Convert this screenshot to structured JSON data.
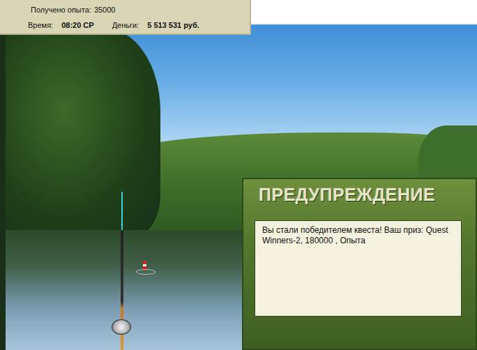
{
  "header": {
    "experience_label": "Получено опыта:",
    "experience_value": "35000",
    "time_label": "Время:",
    "time_value": "08:20 СР",
    "money_label": "Деньги:",
    "money_value": "5 513 531 руб."
  },
  "dialog": {
    "title": "ПРЕДУПРЕЖДЕНИЕ",
    "message": "Вы стали победителем квеста! Ваш приз: Quest Winners-2, 180000 , Опыта"
  }
}
